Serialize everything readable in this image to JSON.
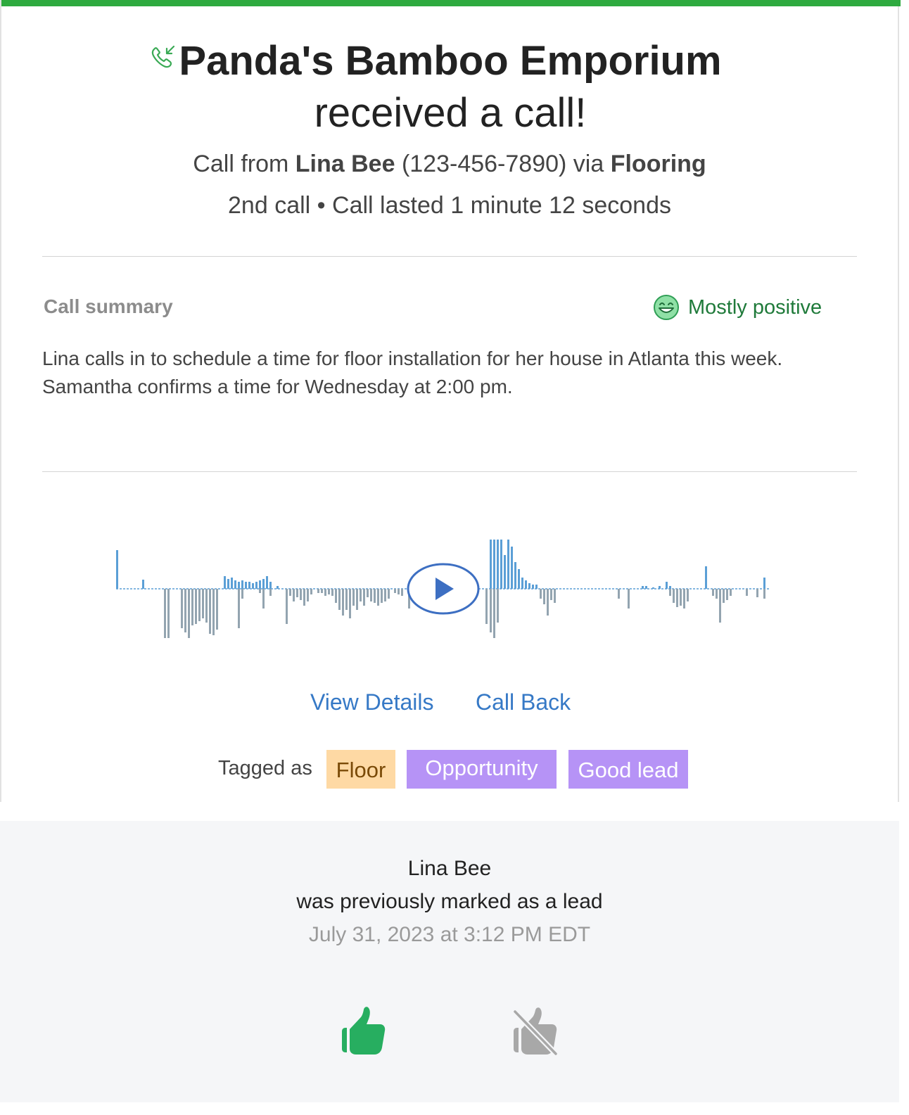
{
  "header": {
    "title_line1": "Panda's Bamboo Emporium",
    "title_line2": "received a call!",
    "call_from_prefix": "Call from",
    "caller_name": "Lina Bee",
    "caller_phone": "(123-456-7890)",
    "via_word": "via",
    "source": "Flooring",
    "call_count": "2nd call",
    "separator": "•",
    "duration_text": "Call lasted 1 minute 12 seconds"
  },
  "summary": {
    "label": "Call summary",
    "sentiment": "Mostly positive",
    "text": "Lina calls in to schedule a time for floor installation for her house in Atlanta this week. Samantha confirms a time for Wednesday at 2:00 pm."
  },
  "player": {
    "play_icon": "play-icon",
    "colors": {
      "agent": "#5b9fd6",
      "caller": "#93a4b0",
      "play_border": "#3d6fc2",
      "play_fill": "#3d6fc2"
    }
  },
  "actions": {
    "view_details": "View Details",
    "call_back": "Call Back"
  },
  "tags": {
    "label": "Tagged as",
    "items": [
      "Floor",
      "Opportunity",
      "Good lead"
    ]
  },
  "footer": {
    "name": "Lina Bee",
    "message": "was previously marked as a lead",
    "date": "July 31, 2023 at 3:12 PM EDT"
  },
  "colors": {
    "accent_green": "#2eaa3f",
    "link_blue": "#3679c6",
    "thumb_up": "#27ae60",
    "thumb_off": "#a8a8a8",
    "tag_floor_bg": "#fed9a4",
    "tag_purple_bg": "#b693f6"
  }
}
